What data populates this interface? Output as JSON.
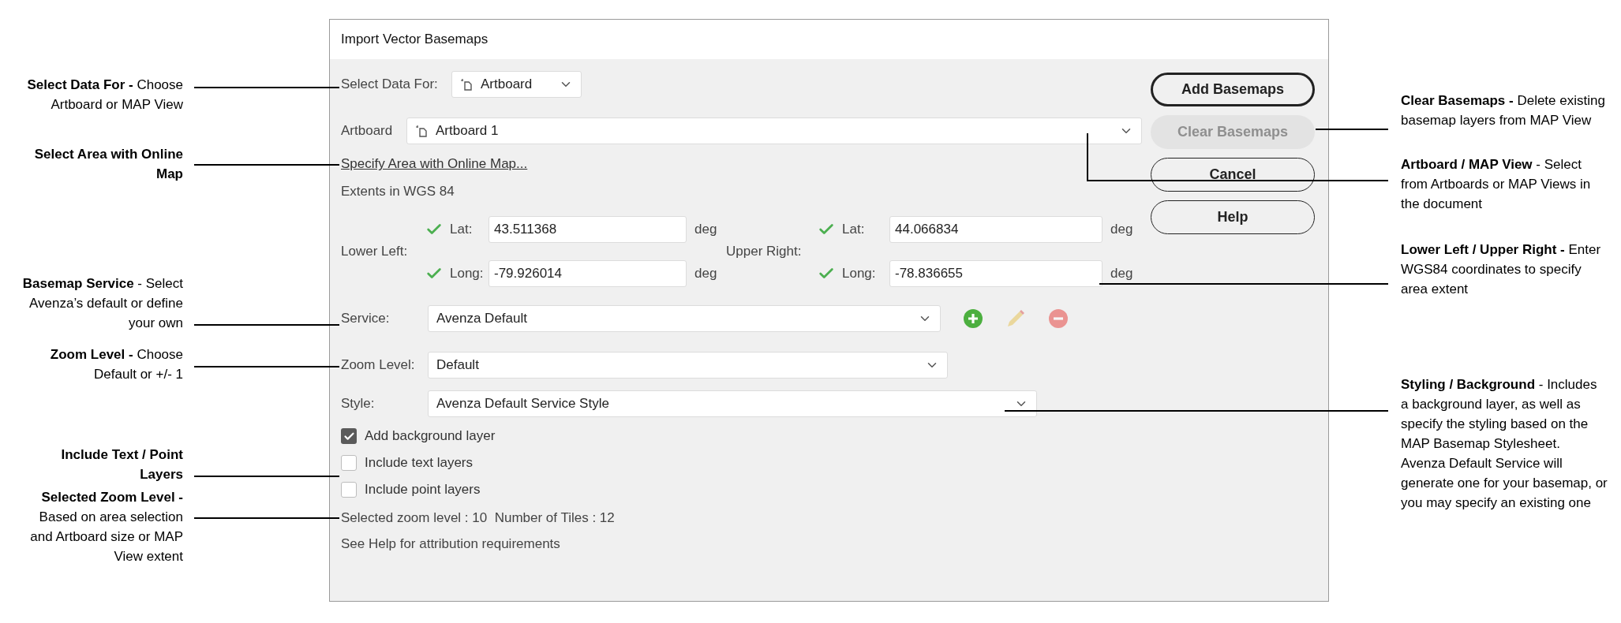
{
  "left_callouts": [
    {
      "title": "Select Data For -",
      "body": "Choose Artboard or MAP View"
    },
    {
      "title": "Select Area with Online Map"
    },
    {
      "title": "Basemap Service",
      "body": "- Select Avenza’s default or define your own"
    },
    {
      "title": "Zoom Level -",
      "body": "Choose Default or +/- 1"
    },
    {
      "title": "Include Text / Point Layers"
    },
    {
      "title": "Selected Zoom Level -",
      "body": "Based on area selection and Artboard size or MAP View extent"
    }
  ],
  "right_callouts": [
    {
      "title": "Clear Basemaps -",
      "body": "Delete existing basemap layers from MAP View"
    },
    {
      "title": "Artboard / MAP View",
      "body": "- Select from Artboards or MAP Views in the document"
    },
    {
      "title": "Lower Left / Upper Right -",
      "body": "Enter WGS84 coordinates to specify area extent"
    },
    {
      "title": "Styling / Background",
      "body": "- Includes a background layer, as well as specify the styling based on the MAP Basemap Stylesheet. Avenza Default Service will generate one for your basemap, or you may specify an existing one"
    }
  ],
  "dialog": {
    "title": "Import Vector Basemaps",
    "select_data_for": {
      "label": "Select Data For:",
      "value": "Artboard"
    },
    "artboard": {
      "label": "Artboard",
      "value": "Artboard 1"
    },
    "area_link": "Specify Area with Online Map...",
    "extents_label": "Extents in WGS 84",
    "corners": [
      {
        "label": "Lower Left:",
        "fields": [
          {
            "label": "Lat:",
            "value": "43.511368",
            "valid": true,
            "unit": "deg"
          },
          {
            "label": "Long:",
            "value": "-79.926014",
            "valid": true,
            "unit": "deg"
          }
        ]
      },
      {
        "label": "Upper Right:",
        "fields": [
          {
            "label": "Lat:",
            "value": "44.066834",
            "valid": true,
            "unit": "deg"
          },
          {
            "label": "Long:",
            "value": "-78.836655",
            "valid": true,
            "unit": "deg"
          }
        ]
      }
    ],
    "service": {
      "label": "Service:",
      "value": "Avenza Default",
      "actions": [
        {
          "kind": "add",
          "disabled": false
        },
        {
          "kind": "edit",
          "disabled": true
        },
        {
          "kind": "remove",
          "disabled": true
        }
      ]
    },
    "zoom_level": {
      "label": "Zoom Level:",
      "value": "Default"
    },
    "style": {
      "label": "Style:",
      "value": "Avenza Default Service Style"
    },
    "checkboxes": [
      {
        "label": "Add background layer",
        "checked": true
      },
      {
        "label": "Include text layers",
        "checked": false
      },
      {
        "label": "Include point layers",
        "checked": false
      }
    ],
    "zoom_info": "Selected zoom level : 10  Number of Tiles : 12",
    "attribution_note": "See Help for attribution requirements",
    "buttons": [
      {
        "label": "Add Basemaps",
        "kind": "default",
        "disabled": false
      },
      {
        "label": "Clear Basemaps",
        "kind": "normal",
        "disabled": true
      },
      {
        "label": "Cancel",
        "kind": "normal",
        "disabled": false
      },
      {
        "label": "Help",
        "kind": "normal",
        "disabled": false
      }
    ]
  }
}
